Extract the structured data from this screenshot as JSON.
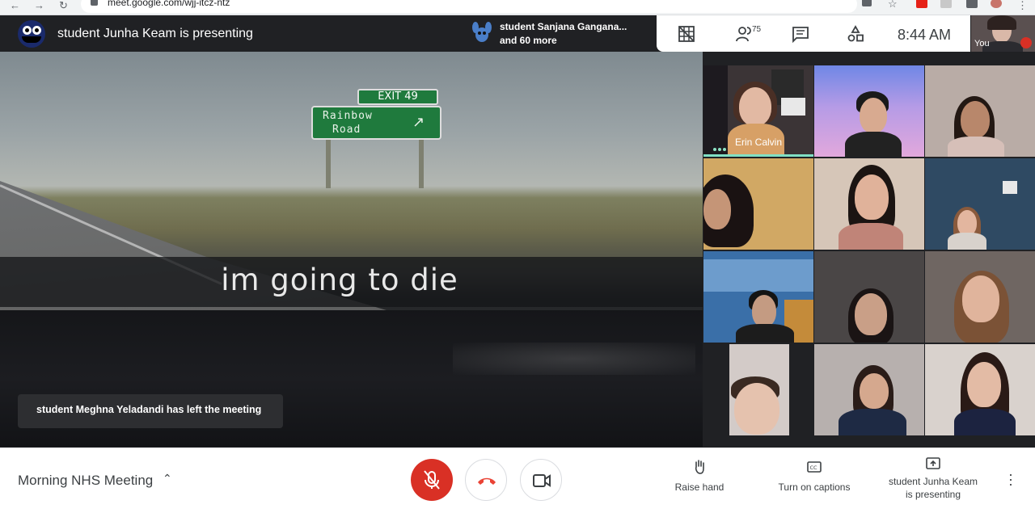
{
  "browser": {
    "url": "meet.google.com/wjj-itcz-ntz"
  },
  "presenter_bar": {
    "title": "student Junha Keam is presenting"
  },
  "active_speaker": {
    "name": "student Sanjana Gangana...",
    "more": "and 60 more"
  },
  "controls": {
    "people_count": "75",
    "time": "8:44  AM",
    "self_label": "You"
  },
  "presentation": {
    "exit_sign": "EXIT 49",
    "sign_line1": "Rainbow",
    "sign_line2": "Road",
    "caption": "im going to die"
  },
  "toast": {
    "text": "student Meghna Yeladandi has left the meeting"
  },
  "participants": [
    {
      "name": "Erin Calvin",
      "active": true
    },
    {
      "name": ""
    },
    {
      "name": ""
    },
    {
      "name": ""
    },
    {
      "name": ""
    },
    {
      "name": ""
    },
    {
      "name": ""
    },
    {
      "name": ""
    },
    {
      "name": ""
    },
    {
      "name": ""
    },
    {
      "name": ""
    },
    {
      "name": ""
    }
  ],
  "bottom": {
    "meeting_title": "Morning NHS Meeting",
    "raise_hand": "Raise hand",
    "captions": "Turn on captions",
    "presenting_line1": "student Junha Keam",
    "presenting_line2": "is presenting"
  },
  "colors": {
    "end_call": "#ea4335",
    "mic_off": "#d93025",
    "active_speaker_bar": "#80e0c5",
    "sign_green": "#1f7a3d"
  }
}
